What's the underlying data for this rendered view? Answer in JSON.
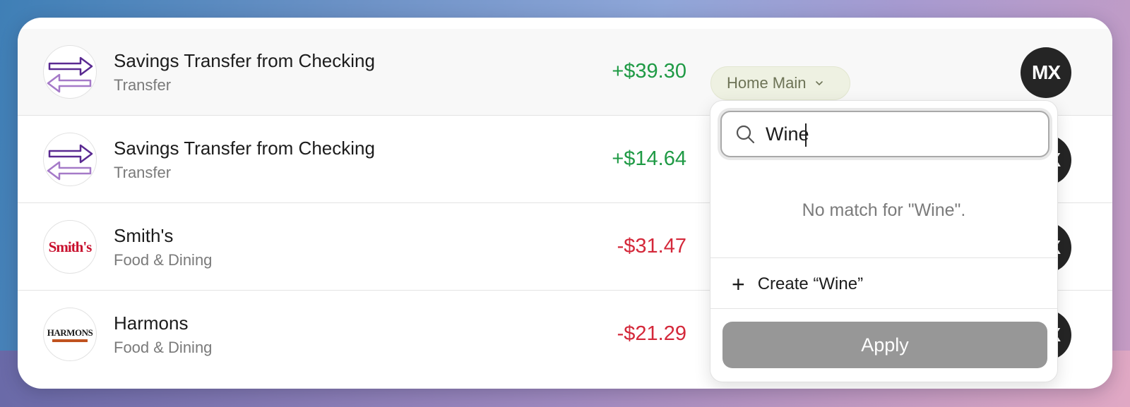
{
  "transactions": [
    {
      "name": "Savings Transfer from Checking",
      "category": "Transfer",
      "amount": "+$39.30",
      "logo": "transfer-icon"
    },
    {
      "name": "Savings Transfer from Checking",
      "category": "Transfer",
      "amount": "+$14.64",
      "logo": "transfer-icon"
    },
    {
      "name": "Smith's",
      "category": "Food & Dining",
      "amount": "-$31.47",
      "logo_text": "Smith's"
    },
    {
      "name": "Harmons",
      "category": "Food & Dining",
      "amount": "-$21.29",
      "logo_text": "HARMONS"
    }
  ],
  "account_selector": {
    "label": "Home Main"
  },
  "avatar": {
    "text": "MX"
  },
  "dropdown": {
    "search_value": "Wine",
    "no_match_text": "No match for \"Wine\".",
    "create_label": "Create “Wine”",
    "apply_label": "Apply"
  },
  "colors": {
    "positive": "#1f9a45",
    "negative": "#d4283a",
    "apply_disabled": "#979797"
  }
}
